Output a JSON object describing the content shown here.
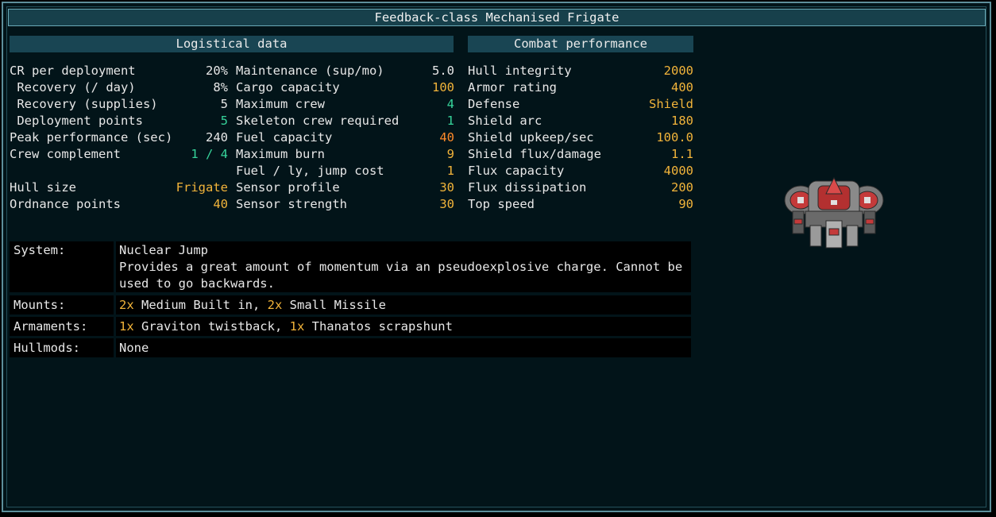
{
  "title": "Feedback-class Mechanised Frigate",
  "sections": {
    "logistical": "Logistical data",
    "combat": "Combat performance"
  },
  "col1": [
    {
      "label": "CR per deployment",
      "value": "20%",
      "color": "white"
    },
    {
      "label": " Recovery (/ day)",
      "value": "8%",
      "color": "white"
    },
    {
      "label": " Recovery (supplies)",
      "value": "5",
      "color": "white"
    },
    {
      "label": " Deployment points",
      "value": "5",
      "color": "teal"
    },
    {
      "label": "Peak performance (sec)",
      "value": "240",
      "color": "white"
    },
    {
      "label": "Crew complement",
      "value": "1 / 4",
      "color": "teal"
    },
    {
      "label": "",
      "value": "",
      "color": "white"
    },
    {
      "label": "Hull size",
      "value": "Frigate",
      "color": "yellow"
    },
    {
      "label": "Ordnance points",
      "value": "40",
      "color": "yellow"
    }
  ],
  "col2": [
    {
      "label": "Maintenance (sup/mo)",
      "value": "5.0",
      "color": "white"
    },
    {
      "label": "Cargo capacity",
      "value": "100",
      "color": "yellow"
    },
    {
      "label": "Maximum crew",
      "value": "4",
      "color": "teal"
    },
    {
      "label": "Skeleton crew required",
      "value": "1",
      "color": "teal"
    },
    {
      "label": "Fuel capacity",
      "value": "40",
      "color": "orange"
    },
    {
      "label": "Maximum burn",
      "value": "9",
      "color": "yellow"
    },
    {
      "label": "Fuel / ly, jump cost",
      "value": "1",
      "color": "yellow"
    },
    {
      "label": "Sensor profile",
      "value": "30",
      "color": "yellow"
    },
    {
      "label": "Sensor strength",
      "value": "30",
      "color": "yellow"
    }
  ],
  "col3": [
    {
      "label": "Hull integrity",
      "value": "2000",
      "color": "yellow"
    },
    {
      "label": "Armor rating",
      "value": "400",
      "color": "yellow"
    },
    {
      "label": "Defense",
      "value": "Shield",
      "color": "yellow"
    },
    {
      "label": "Shield arc",
      "value": "180",
      "color": "yellow"
    },
    {
      "label": "Shield upkeep/sec",
      "value": "100.0",
      "color": "yellow"
    },
    {
      "label": "Shield flux/damage",
      "value": "1.1",
      "color": "yellow"
    },
    {
      "label": "Flux capacity",
      "value": "4000",
      "color": "yellow"
    },
    {
      "label": "Flux dissipation",
      "value": "200",
      "color": "yellow"
    },
    {
      "label": "Top speed",
      "value": "90",
      "color": "yellow"
    }
  ],
  "system": {
    "key": "System:",
    "name": "Nuclear Jump",
    "desc_line1": "Provides a great amount of momentum via an pseudoexplosive charge. Cannot be",
    "desc_line2": "used to go backwards."
  },
  "mounts": {
    "key": "Mounts:",
    "n1": "2x",
    "t1": " Medium Built in, ",
    "n2": "2x",
    "t2": " Small Missile"
  },
  "armaments": {
    "key": "Armaments:",
    "n1": "1x",
    "t1": " Graviton twistback, ",
    "n2": "1x",
    "t2": " Thanatos scrapshunt"
  },
  "hullmods": {
    "key": "Hullmods:",
    "value": "None"
  },
  "colors": {
    "white": "#e8e8e8",
    "teal": "#36d39a",
    "yellow": "#f2b43a",
    "orange": "#ff8a2a",
    "panel": "#021419",
    "border": "#5d8f9b",
    "header": "#194553"
  }
}
